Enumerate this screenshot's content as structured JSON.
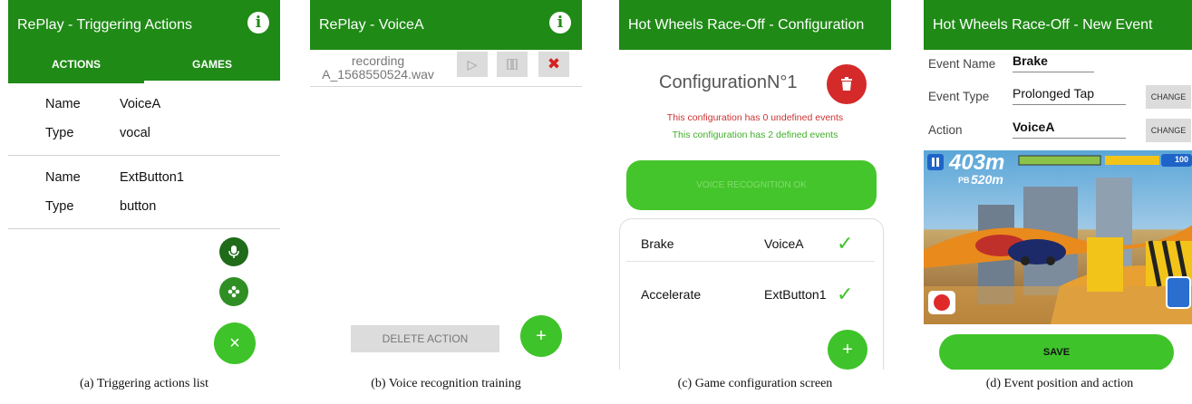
{
  "panel_a": {
    "title": "RePlay - Triggering Actions",
    "tabs": [
      "ACTIONS",
      "GAMES"
    ],
    "actions": [
      {
        "name_label": "Name",
        "name": "VoiceA",
        "type_label": "Type",
        "type": "vocal"
      },
      {
        "name_label": "Name",
        "name": "ExtButton1",
        "type_label": "Type",
        "type": "button"
      }
    ],
    "fab_close": "×",
    "caption": "(a)  Triggering actions list"
  },
  "panel_b": {
    "title": "RePlay - VoiceA",
    "recording_line1": "recording",
    "recording_line2": "A_1568550524.wav",
    "play": "▷",
    "pause": "⏸",
    "delete_x": "✖",
    "delete_action": "DELETE ACTION",
    "fab_add": "+",
    "caption": "(b)  Voice recognition training"
  },
  "panel_c": {
    "title": "Hot Wheels Race-Off - Configuration",
    "config_name": "ConfigurationN°1",
    "undefined_msg": "This configuration has 0 undefined events",
    "defined_msg": "This configuration has 2 defined events",
    "voice_ok": "VOICE RECOGNITION OK",
    "events": [
      {
        "event": "Brake",
        "action": "VoiceA",
        "check": "✓"
      },
      {
        "event": "Accelerate",
        "action": "ExtButton1",
        "check": "✓"
      }
    ],
    "fab_add": "+",
    "caption": "(c)  Game configuration screen"
  },
  "panel_d": {
    "title": "Hot Wheels Race-Off - New Event",
    "fields": [
      {
        "label": "Event Name",
        "value": "Brake"
      },
      {
        "label": "Event Type",
        "value": "Prolonged Tap",
        "button": "CHANGE"
      },
      {
        "label": "Action",
        "value": "VoiceA",
        "button": "CHANGE"
      }
    ],
    "game": {
      "distance": "403m",
      "best_label": "PB",
      "best": "520m",
      "coins": "100"
    },
    "save": "SAVE",
    "caption": "(d)  Event position and action"
  },
  "colors": {
    "green_bar": "#1f8a16",
    "green_bright": "#3fc32a",
    "red_button": "#d42a2a"
  }
}
